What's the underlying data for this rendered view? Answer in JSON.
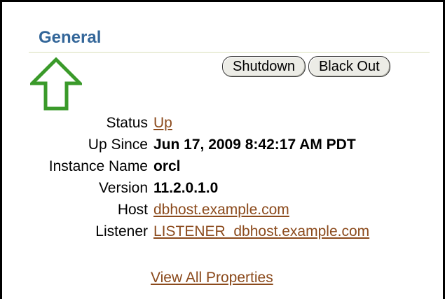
{
  "section": {
    "title": "General"
  },
  "buttons": {
    "shutdown_label": "Shutdown",
    "blackout_label": "Black Out"
  },
  "properties": {
    "status_label": "Status",
    "status_value": "Up",
    "up_since_label": "Up Since",
    "up_since_value": "Jun 17, 2009 8:42:17 AM PDT",
    "instance_name_label": "Instance Name",
    "instance_name_value": "orcl",
    "version_label": "Version",
    "version_value": "11.2.0.1.0",
    "host_label": "Host",
    "host_value": "dbhost.example.com",
    "listener_label": "Listener",
    "listener_value": "LISTENER_dbhost.example.com"
  },
  "footer": {
    "view_all_label": "View All Properties"
  },
  "icons": {
    "callout_arrow": "up-arrow-icon"
  },
  "colors": {
    "title": "#336699",
    "link": "#8b4a1c",
    "arrow": "#3a9a2a",
    "rule": "#d9dfb9"
  }
}
